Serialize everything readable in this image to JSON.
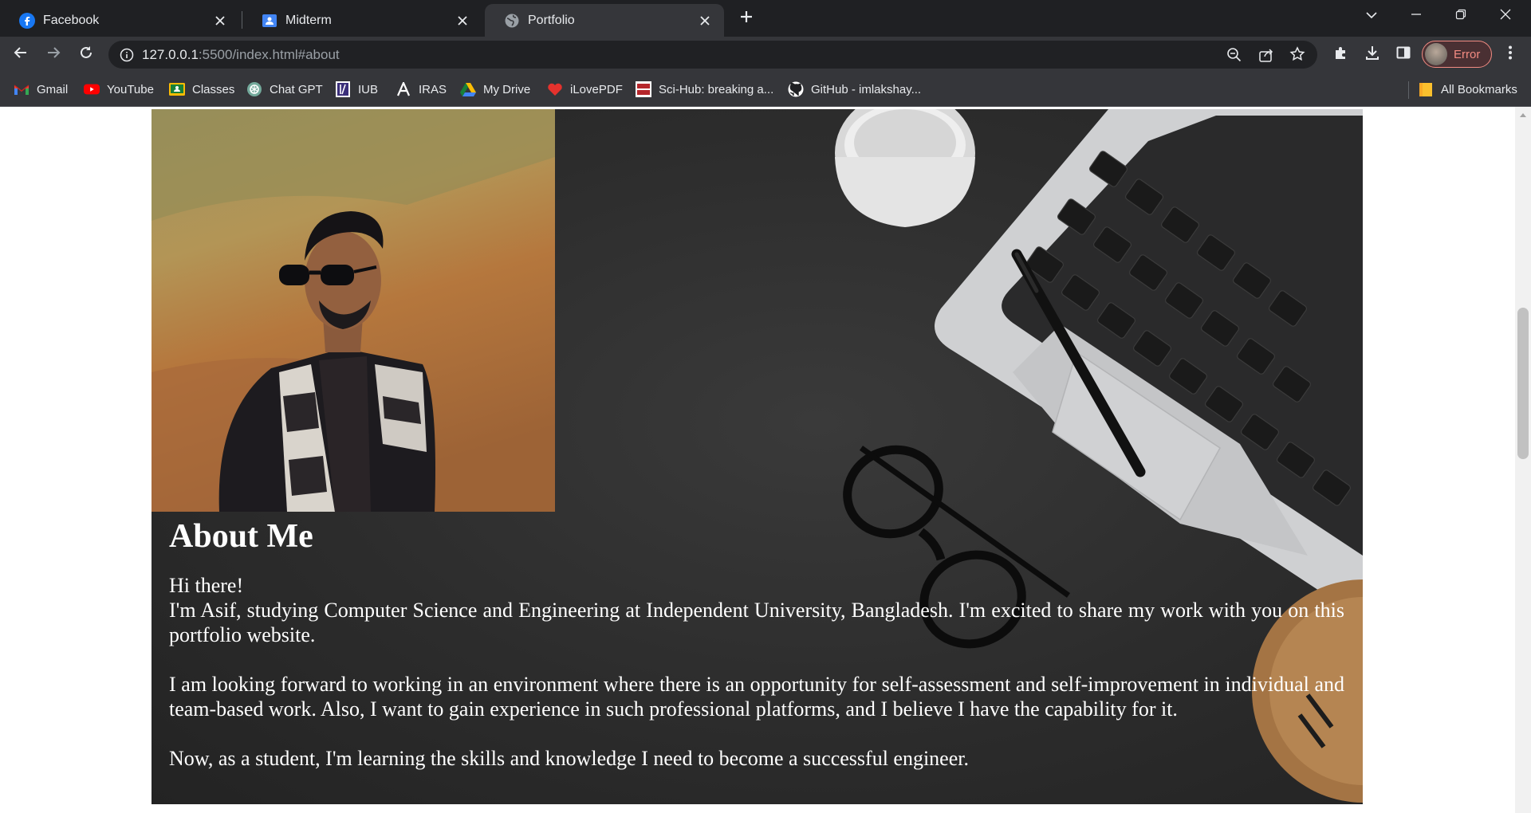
{
  "browser": {
    "tabs": [
      {
        "title": "Facebook",
        "icon": "facebook-icon",
        "active": false
      },
      {
        "title": "Midterm",
        "icon": "classroom-icon",
        "active": false
      },
      {
        "title": "Portfolio",
        "icon": "globe-icon",
        "active": true
      }
    ],
    "url_host": "127.0.0.1",
    "url_rest": ":5500/index.html#about",
    "profile_label": "Error",
    "bookmarks": [
      {
        "label": "Gmail",
        "icon": "gmail-icon"
      },
      {
        "label": "YouTube",
        "icon": "youtube-icon"
      },
      {
        "label": "Classes",
        "icon": "classroom-icon"
      },
      {
        "label": "Chat GPT",
        "icon": "chatgpt-icon"
      },
      {
        "label": "IUB",
        "icon": "iub-icon"
      },
      {
        "label": "IRAS",
        "icon": "iras-icon"
      },
      {
        "label": "My Drive",
        "icon": "drive-icon"
      },
      {
        "label": "iLovePDF",
        "icon": "ilovepdf-icon"
      },
      {
        "label": "Sci-Hub: breaking a...",
        "icon": "scihub-icon"
      },
      {
        "label": "GitHub - imlakshay...",
        "icon": "github-icon"
      }
    ],
    "all_bookmarks_label": "All Bookmarks"
  },
  "page": {
    "about": {
      "heading": "About Me",
      "greeting": "Hi there!",
      "intro": "I'm Asif, studying Computer Science and Engineering at Independent University, Bangladesh. I'm excited to share my work with you on this portfolio website.",
      "goals": "I am looking forward to working in an environment where there is an opportunity for self-assessment and self-improvement in individual and team-based work. Also, I want to gain experience in such professional platforms, and I believe I have the capability for it.",
      "student": "Now, as a student, I'm learning the skills and knowledge I need to become a successful engineer."
    }
  }
}
